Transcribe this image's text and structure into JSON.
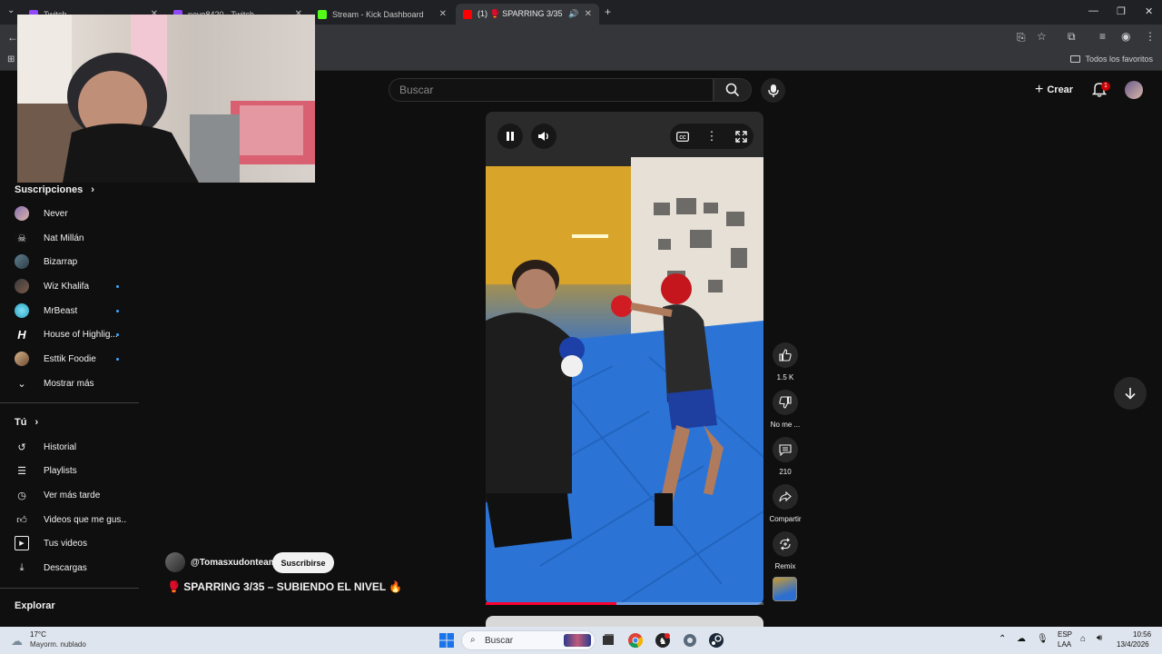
{
  "browser": {
    "tabs": [
      {
        "title": "Twitch",
        "active": false
      },
      {
        "title": "neve8420 - Twitch",
        "active": false
      },
      {
        "title": "Stream - Kick Dashboard",
        "active": false
      },
      {
        "title": "(1) 🥊 SPARRING 3/35 – SU",
        "active": true
      }
    ],
    "bookmark_folder": "Todos los favoritos"
  },
  "header": {
    "search_placeholder": "Buscar",
    "create_label": "Crear",
    "notification_count": "1"
  },
  "sidebar": {
    "subscriptions_heading": "Suscripciones",
    "subscriptions": [
      {
        "label": "Never",
        "new": false
      },
      {
        "label": "Nat Millán",
        "new": false
      },
      {
        "label": "Bizarrap",
        "new": false
      },
      {
        "label": "Wiz Khalifa",
        "new": true
      },
      {
        "label": "MrBeast",
        "new": true
      },
      {
        "label": "House of Highlig...",
        "new": true
      },
      {
        "label": "Esttik Foodie",
        "new": true
      },
      {
        "label": "Mostrar más",
        "new": false
      }
    ],
    "you_heading": "Tú",
    "you_items": [
      {
        "label": "Historial"
      },
      {
        "label": "Playlists"
      },
      {
        "label": "Ver más tarde"
      },
      {
        "label": "Videos que me gus..."
      },
      {
        "label": "Tus videos"
      },
      {
        "label": "Descargas"
      }
    ],
    "explore_heading": "Explorar"
  },
  "short": {
    "channel": "@Tomasxudonteam",
    "subscribe_label": "Suscribirse",
    "title": "🥊 SPARRING 3/35 – SUBIENDO EL NIVEL 🔥",
    "progress": 0.47,
    "actions": {
      "likes": "1.5 K",
      "dislike": "No me ...",
      "comments": "210",
      "share": "Compartir",
      "remix": "Remix"
    }
  },
  "taskbar": {
    "weather_temp": "17°C",
    "weather_desc": "Mayorm. nublado",
    "search_label": "Buscar",
    "lang_top": "ESP",
    "lang_bottom": "LAA",
    "time": "10:56",
    "date": "13/4/2026"
  },
  "colors": {
    "accent_red": "#ff0033",
    "new_dot": "#3ea6ff",
    "bg": "#0f0f0f"
  }
}
